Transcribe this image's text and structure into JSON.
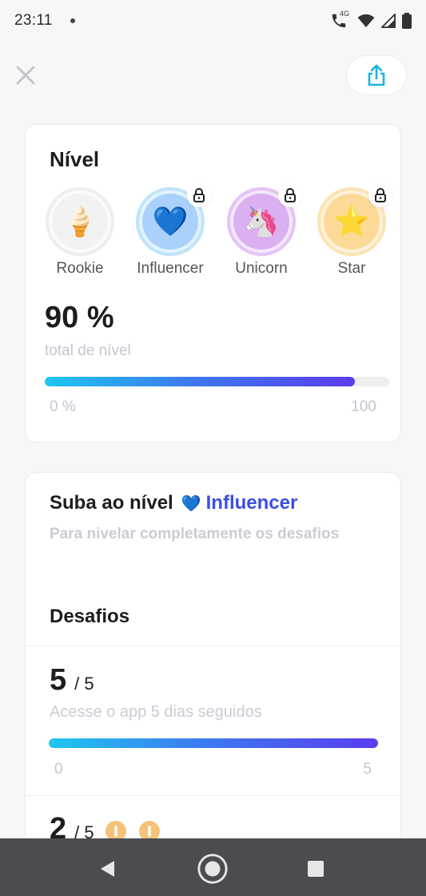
{
  "status_bar": {
    "time": "23:11",
    "network": "4G"
  },
  "header": {
    "close_icon": "close-icon",
    "share_icon": "share-icon"
  },
  "level_card": {
    "title": "Nível",
    "levels": [
      {
        "label": "Rookie",
        "icon": "ice-cream-icon",
        "emoji": "🍦",
        "locked": false,
        "ring": "#eeeeee",
        "fill": "#f2f2f2"
      },
      {
        "label": "Influencer",
        "icon": "blue-heart-icon",
        "emoji": "💙",
        "locked": true,
        "ring": "#bfe4fb",
        "fill": "#a9d1fb"
      },
      {
        "label": "Unicorn",
        "icon": "unicorn-icon",
        "emoji": "🦄",
        "locked": true,
        "ring": "#e3c4f5",
        "fill": "#dbb0f1"
      },
      {
        "label": "Star",
        "icon": "star-icon",
        "emoji": "⭐",
        "locked": true,
        "ring": "#fde3b4",
        "fill": "#fdd997"
      }
    ],
    "percent_text": "90 %",
    "caption": "total de nível",
    "progress": 0.9,
    "min_label": "0 %",
    "max_label": "100"
  },
  "challenge_card": {
    "subtitle_prefix": "Suba ao nível",
    "subtitle_icon": "💙",
    "subtitle_level": "Influencer",
    "description": "Para nivelar completamente os desafios",
    "section_title": "Desafios",
    "challenges": [
      {
        "count": "5",
        "total": "/ 5",
        "description": "Acesse o app 5 dias seguidos",
        "progress": 1.0,
        "min_label": "0",
        "max_label": "5"
      },
      {
        "count": "2",
        "total": "/ 5"
      }
    ]
  },
  "colors": {
    "accent": "#3d4ee0",
    "gradient_start": "#1fc6f0",
    "gradient_end": "#5a3cf0"
  }
}
